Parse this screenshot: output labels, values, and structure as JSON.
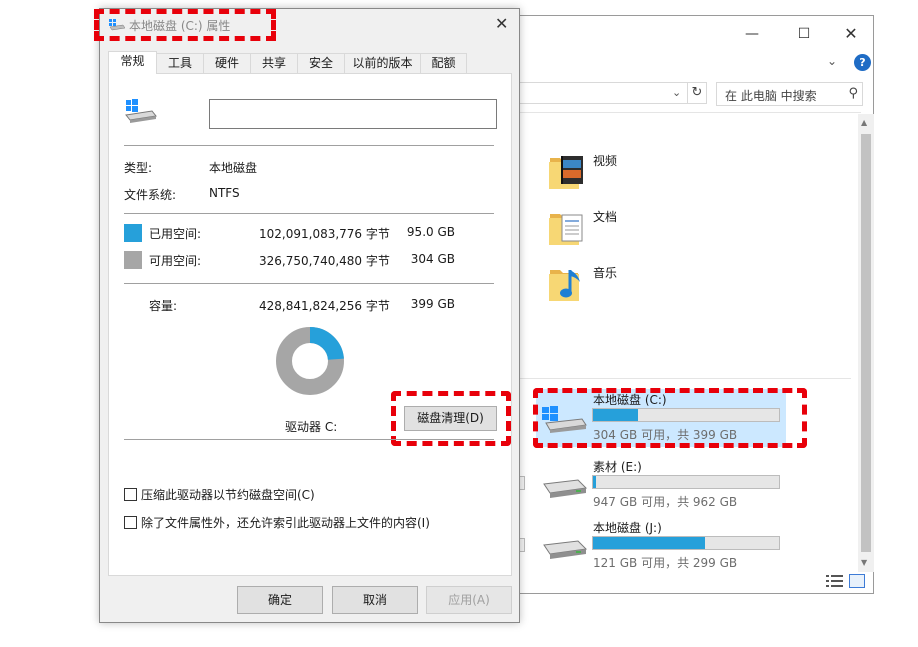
{
  "colors": {
    "used": "#26a0da",
    "free": "#a6a6a6",
    "highlight": "#e8000a",
    "selection": "#cce8ff",
    "drive_bar_fill": "#26a0da"
  },
  "explorer": {
    "minimize_icon": "minimize-icon",
    "maximize_icon": "maximize-icon",
    "close_icon": "close-icon",
    "help_label": "?",
    "refresh_icon": "refresh-icon",
    "search_placeholder": "在 此电脑 中搜索",
    "folders": [
      {
        "label": "视频",
        "icon": "videos-folder-icon"
      },
      {
        "label": "文档",
        "icon": "documents-folder-icon"
      },
      {
        "label": "音乐",
        "icon": "music-folder-icon"
      }
    ],
    "drives": [
      {
        "label": "本地磁盘 (C:)",
        "space": "304 GB 可用，共 399 GB",
        "used_fraction": 0.24,
        "selected": true
      },
      {
        "label": "素材 (E:)",
        "space": "947 GB 可用，共 962 GB",
        "used_fraction": 0.016,
        "selected": false
      },
      {
        "label": "本地磁盘 (J:)",
        "space": "121 GB 可用，共 299 GB",
        "used_fraction": 0.6,
        "selected": false
      }
    ]
  },
  "dialog": {
    "title": "本地磁盘 (C:) 属性",
    "tabs": [
      "常规",
      "工具",
      "硬件",
      "共享",
      "安全",
      "以前的版本",
      "配额"
    ],
    "active_tab": 0,
    "name_value": "",
    "type_label": "类型:",
    "type_value": "本地磁盘",
    "fs_label": "文件系统:",
    "fs_value": "NTFS",
    "used_label": "已用空间:",
    "used_bytes": "102,091,083,776 字节",
    "used_gb": "95.0 GB",
    "free_label": "可用空间:",
    "free_bytes": "326,750,740,480 字节",
    "free_gb": "304 GB",
    "capacity_label": "容量:",
    "capacity_bytes": "428,841,824,256 字节",
    "capacity_gb": "399 GB",
    "used_fraction": 0.238,
    "drive_label": "驱动器 C:",
    "cleanup_button": "磁盘清理(D)",
    "compress_label": "压缩此驱动器以节约磁盘空间(C)",
    "index_label": "除了文件属性外，还允许索引此驱动器上文件的内容(I)",
    "ok_button": "确定",
    "cancel_button": "取消",
    "apply_button": "应用(A)"
  }
}
